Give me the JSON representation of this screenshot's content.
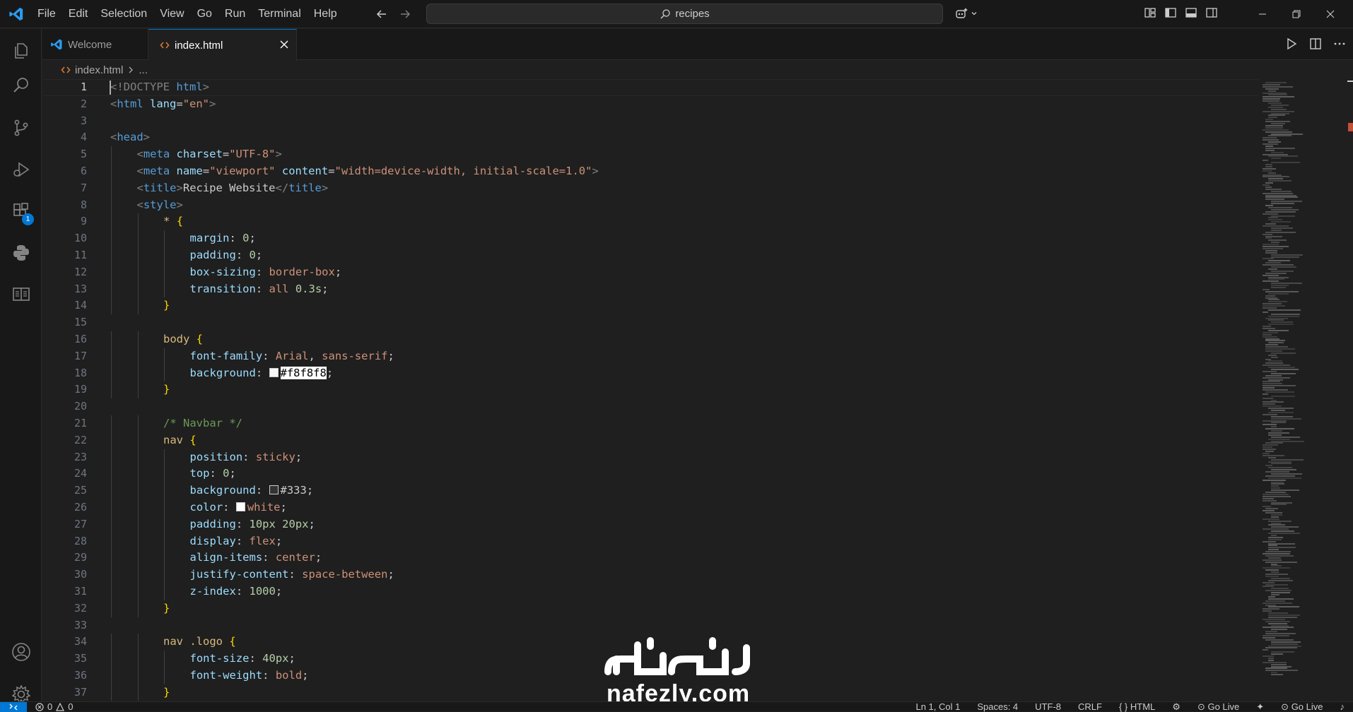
{
  "app": {
    "name": "Visual Studio Code",
    "accent": "#0078d4"
  },
  "menu": [
    "File",
    "Edit",
    "Selection",
    "View",
    "Go",
    "Run",
    "Terminal",
    "Help"
  ],
  "search": {
    "text": "recipes"
  },
  "tabs": [
    {
      "label": "Welcome",
      "icon": "vscode-icon",
      "active": false
    },
    {
      "label": "index.html",
      "icon": "html-file-icon",
      "active": true
    }
  ],
  "breadcrumb": {
    "file": "index.html",
    "rest": "..."
  },
  "activity_badge": "1",
  "editor": {
    "active_line": 1,
    "lines": [
      {
        "n": "1",
        "indent": 0,
        "tokens": [
          [
            "punct",
            "<"
          ],
          [
            "punct",
            "!DOCTYPE "
          ],
          [
            "tag",
            "html"
          ],
          [
            "punct",
            ">"
          ]
        ]
      },
      {
        "n": "2",
        "indent": 0,
        "tokens": [
          [
            "punct",
            "<"
          ],
          [
            "tag",
            "html"
          ],
          [
            "text",
            " "
          ],
          [
            "attr",
            "lang"
          ],
          [
            "text",
            "="
          ],
          [
            "str",
            "\"en\""
          ],
          [
            "punct",
            ">"
          ]
        ]
      },
      {
        "n": "3",
        "indent": 0,
        "tokens": []
      },
      {
        "n": "4",
        "indent": 0,
        "tokens": [
          [
            "punct",
            "<"
          ],
          [
            "tag",
            "head"
          ],
          [
            "punct",
            ">"
          ]
        ]
      },
      {
        "n": "5",
        "indent": 1,
        "tokens": [
          [
            "punct",
            "<"
          ],
          [
            "tag",
            "meta"
          ],
          [
            "text",
            " "
          ],
          [
            "attr",
            "charset"
          ],
          [
            "text",
            "="
          ],
          [
            "str",
            "\"UTF-8\""
          ],
          [
            "punct",
            ">"
          ]
        ]
      },
      {
        "n": "6",
        "indent": 1,
        "tokens": [
          [
            "punct",
            "<"
          ],
          [
            "tag",
            "meta"
          ],
          [
            "text",
            " "
          ],
          [
            "attr",
            "name"
          ],
          [
            "text",
            "="
          ],
          [
            "str",
            "\"viewport\""
          ],
          [
            "text",
            " "
          ],
          [
            "attr",
            "content"
          ],
          [
            "text",
            "="
          ],
          [
            "str",
            "\"width=device-width, initial-scale=1.0\""
          ],
          [
            "punct",
            ">"
          ]
        ]
      },
      {
        "n": "7",
        "indent": 1,
        "tokens": [
          [
            "punct",
            "<"
          ],
          [
            "tag",
            "title"
          ],
          [
            "punct",
            ">"
          ],
          [
            "text",
            "Recipe Website"
          ],
          [
            "punct",
            "</"
          ],
          [
            "tag",
            "title"
          ],
          [
            "punct",
            ">"
          ]
        ]
      },
      {
        "n": "8",
        "indent": 1,
        "tokens": [
          [
            "punct",
            "<"
          ],
          [
            "tag",
            "style"
          ],
          [
            "punct",
            ">"
          ]
        ]
      },
      {
        "n": "9",
        "indent": 2,
        "tokens": [
          [
            "sel",
            "*"
          ],
          [
            "text",
            " "
          ],
          [
            "br",
            "{"
          ]
        ]
      },
      {
        "n": "10",
        "indent": 3,
        "tokens": [
          [
            "prop",
            "margin"
          ],
          [
            "text",
            ": "
          ],
          [
            "num",
            "0"
          ],
          [
            "text",
            ";"
          ]
        ]
      },
      {
        "n": "11",
        "indent": 3,
        "tokens": [
          [
            "prop",
            "padding"
          ],
          [
            "text",
            ": "
          ],
          [
            "num",
            "0"
          ],
          [
            "text",
            ";"
          ]
        ]
      },
      {
        "n": "12",
        "indent": 3,
        "tokens": [
          [
            "prop",
            "box-sizing"
          ],
          [
            "text",
            ": "
          ],
          [
            "val",
            "border-box"
          ],
          [
            "text",
            ";"
          ]
        ]
      },
      {
        "n": "13",
        "indent": 3,
        "tokens": [
          [
            "prop",
            "transition"
          ],
          [
            "text",
            ": "
          ],
          [
            "val",
            "all "
          ],
          [
            "num",
            "0.3s"
          ],
          [
            "text",
            ";"
          ]
        ]
      },
      {
        "n": "14",
        "indent": 2,
        "tokens": [
          [
            "br",
            "}"
          ]
        ]
      },
      {
        "n": "15",
        "indent": 0,
        "tokens": []
      },
      {
        "n": "16",
        "indent": 2,
        "tokens": [
          [
            "sel",
            "body"
          ],
          [
            "text",
            " "
          ],
          [
            "br",
            "{"
          ]
        ]
      },
      {
        "n": "17",
        "indent": 3,
        "tokens": [
          [
            "prop",
            "font-family"
          ],
          [
            "text",
            ": "
          ],
          [
            "val",
            "Arial"
          ],
          [
            "text",
            ", "
          ],
          [
            "val",
            "sans-serif"
          ],
          [
            "text",
            ";"
          ]
        ]
      },
      {
        "n": "18",
        "indent": 3,
        "tokens": [
          [
            "prop",
            "background"
          ],
          [
            "text",
            ": "
          ],
          [
            "swatch",
            "#f8f8f8"
          ],
          [
            "hl",
            "#f8f8f8"
          ],
          [
            "text",
            ";"
          ]
        ]
      },
      {
        "n": "19",
        "indent": 2,
        "tokens": [
          [
            "br",
            "}"
          ]
        ]
      },
      {
        "n": "20",
        "indent": 0,
        "tokens": []
      },
      {
        "n": "21",
        "indent": 2,
        "tokens": [
          [
            "com",
            "/* Navbar */"
          ]
        ]
      },
      {
        "n": "22",
        "indent": 2,
        "tokens": [
          [
            "sel",
            "nav"
          ],
          [
            "text",
            " "
          ],
          [
            "br",
            "{"
          ]
        ]
      },
      {
        "n": "23",
        "indent": 3,
        "tokens": [
          [
            "prop",
            "position"
          ],
          [
            "text",
            ": "
          ],
          [
            "val",
            "sticky"
          ],
          [
            "text",
            ";"
          ]
        ]
      },
      {
        "n": "24",
        "indent": 3,
        "tokens": [
          [
            "prop",
            "top"
          ],
          [
            "text",
            ": "
          ],
          [
            "num",
            "0"
          ],
          [
            "text",
            ";"
          ]
        ]
      },
      {
        "n": "25",
        "indent": 3,
        "tokens": [
          [
            "prop",
            "background"
          ],
          [
            "text",
            ": "
          ],
          [
            "swatch",
            "#333"
          ],
          [
            "text",
            "#333"
          ],
          [
            "text",
            ";"
          ]
        ]
      },
      {
        "n": "26",
        "indent": 3,
        "tokens": [
          [
            "prop",
            "color"
          ],
          [
            "text",
            ": "
          ],
          [
            "swatch",
            "#ffffff"
          ],
          [
            "val",
            "white"
          ],
          [
            "text",
            ";"
          ]
        ]
      },
      {
        "n": "27",
        "indent": 3,
        "tokens": [
          [
            "prop",
            "padding"
          ],
          [
            "text",
            ": "
          ],
          [
            "num",
            "10px"
          ],
          [
            "text",
            " "
          ],
          [
            "num",
            "20px"
          ],
          [
            "text",
            ";"
          ]
        ]
      },
      {
        "n": "28",
        "indent": 3,
        "tokens": [
          [
            "prop",
            "display"
          ],
          [
            "text",
            ": "
          ],
          [
            "val",
            "flex"
          ],
          [
            "text",
            ";"
          ]
        ]
      },
      {
        "n": "29",
        "indent": 3,
        "tokens": [
          [
            "prop",
            "align-items"
          ],
          [
            "text",
            ": "
          ],
          [
            "val",
            "center"
          ],
          [
            "text",
            ";"
          ]
        ]
      },
      {
        "n": "30",
        "indent": 3,
        "tokens": [
          [
            "prop",
            "justify-content"
          ],
          [
            "text",
            ": "
          ],
          [
            "val",
            "space-between"
          ],
          [
            "text",
            ";"
          ]
        ]
      },
      {
        "n": "31",
        "indent": 3,
        "tokens": [
          [
            "prop",
            "z-index"
          ],
          [
            "text",
            ": "
          ],
          [
            "num",
            "1000"
          ],
          [
            "text",
            ";"
          ]
        ]
      },
      {
        "n": "32",
        "indent": 2,
        "tokens": [
          [
            "br",
            "}"
          ]
        ]
      },
      {
        "n": "33",
        "indent": 0,
        "tokens": []
      },
      {
        "n": "34",
        "indent": 2,
        "tokens": [
          [
            "sel",
            "nav .logo"
          ],
          [
            "text",
            " "
          ],
          [
            "br",
            "{"
          ]
        ]
      },
      {
        "n": "35",
        "indent": 3,
        "tokens": [
          [
            "prop",
            "font-size"
          ],
          [
            "text",
            ": "
          ],
          [
            "num",
            "40px"
          ],
          [
            "text",
            ";"
          ]
        ]
      },
      {
        "n": "36",
        "indent": 3,
        "tokens": [
          [
            "prop",
            "font-weight"
          ],
          [
            "text",
            ": "
          ],
          [
            "val",
            "bold"
          ],
          [
            "text",
            ";"
          ]
        ]
      },
      {
        "n": "37",
        "indent": 2,
        "tokens": [
          [
            "br",
            "}"
          ]
        ]
      }
    ]
  },
  "status": {
    "remote": "><",
    "errors": "0",
    "warnings": "0",
    "position": "Ln 1, Col 1",
    "spaces": "Spaces: 4",
    "encoding": "UTF-8",
    "eol": "CRLF",
    "language": "HTML",
    "golive1": "Go Live",
    "golive2": "Go Live"
  },
  "watermark": {
    "arabic": "نفذلي",
    "latin": "nafezly.com"
  }
}
